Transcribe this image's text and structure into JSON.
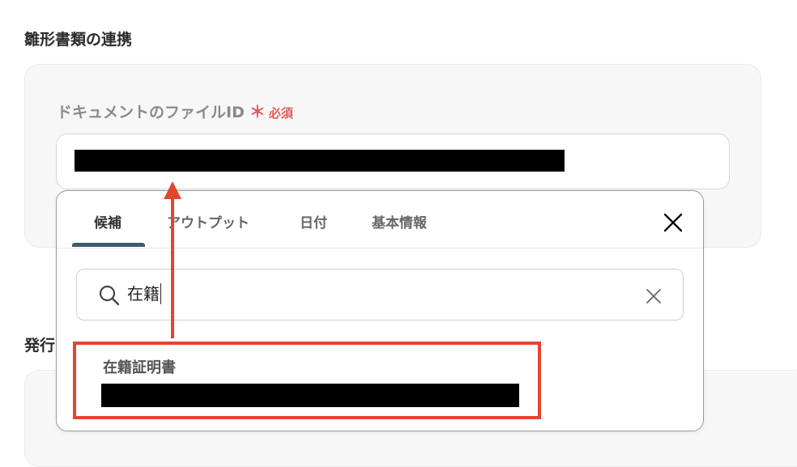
{
  "section_title": "雛形書類の連携",
  "field": {
    "label": "ドキュメントのファイルID",
    "required_mark": "＊",
    "required_text": "必須"
  },
  "section2_title": "発行",
  "popup": {
    "tabs": [
      {
        "label": "候補",
        "active": true
      },
      {
        "label": "アウトプット",
        "active": false
      },
      {
        "label": "日付",
        "active": false
      },
      {
        "label": "基本情報",
        "active": false
      }
    ],
    "search": {
      "value": "在籍",
      "icon": "search-icon"
    },
    "results": [
      {
        "title": "在籍証明書"
      }
    ]
  },
  "colors": {
    "accent_tab": "#3d5a6e",
    "required": "#e05a5a",
    "highlight": "#e2462f"
  }
}
